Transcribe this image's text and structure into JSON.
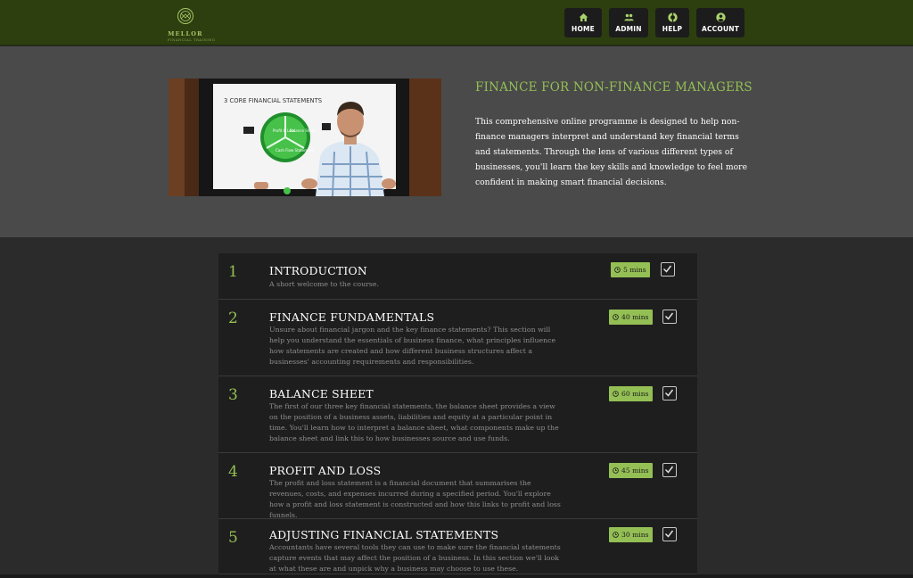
{
  "brand": {
    "name": "MELLOR",
    "tagline": "FINANCIAL TRAINING"
  },
  "nav": [
    {
      "label": "HOME",
      "icon": "home-icon"
    },
    {
      "label": "ADMIN",
      "icon": "users-icon"
    },
    {
      "label": "HELP",
      "icon": "lifebuoy-icon"
    },
    {
      "label": "ACCOUNT",
      "icon": "user-circle-icon"
    }
  ],
  "hero": {
    "title": "FINANCE FOR NON-FINANCE MANAGERS",
    "description": "This comprehensive online programme is designed to help non-finance managers interpret and understand key financial terms and statements. Through the lens of various different types of businesses, you'll learn the key skills and knowledge to feel more confident in making smart financial decisions.",
    "image": {
      "slide_title": "3 CORE FINANCIAL STATEMENTS",
      "segments": [
        "Profit & Loss",
        "Balance Sheet",
        "Cash Flow Statement"
      ]
    }
  },
  "modules": [
    {
      "number": "1",
      "title": "INTRODUCTION",
      "description": "A short welcome to the course.",
      "duration": "5 mins",
      "completed": true
    },
    {
      "number": "2",
      "title": "FINANCE FUNDAMENTALS",
      "description": "Unsure about financial jargon and the key finance statements? This section will help you understand the essentials of business finance, what principles influence how statements are created and how different business structures affect a businesses' accounting requirements and responsibilities.",
      "duration": "40 mins",
      "completed": true
    },
    {
      "number": "3",
      "title": "BALANCE SHEET",
      "description": "The first of our three key financial statements, the balance sheet provides a view on the position of a business assets, liabilities and equity at a particular point in time. You'll learn how to interpret a balance sheet, what components make up the balance sheet and link this to how businesses source and use funds.",
      "duration": "60 mins",
      "completed": true
    },
    {
      "number": "4",
      "title": "PROFIT AND LOSS",
      "description": "The profit and loss statement is a financial document that summarises the revenues, costs, and expenses incurred during a specified period. You'll explore how a profit and loss statement is constructed and how this links to profit and loss funnels.",
      "duration": "45 mins",
      "completed": true
    },
    {
      "number": "5",
      "title": "ADJUSTING FINANCIAL STATEMENTS",
      "description": "Accountants have several tools they can use to make sure the financial statements capture events that may affect the position of a business. In this section we'll look at what these are and unpick why a business may choose to use these.",
      "duration": "30 mins",
      "completed": true
    }
  ],
  "colors": {
    "header_bg": "#2d3f0f",
    "accent": "#94bf54",
    "hero_bg": "#4a4a4a",
    "card_bg": "#1e1e1e",
    "page_bg": "#2b2b2b"
  }
}
